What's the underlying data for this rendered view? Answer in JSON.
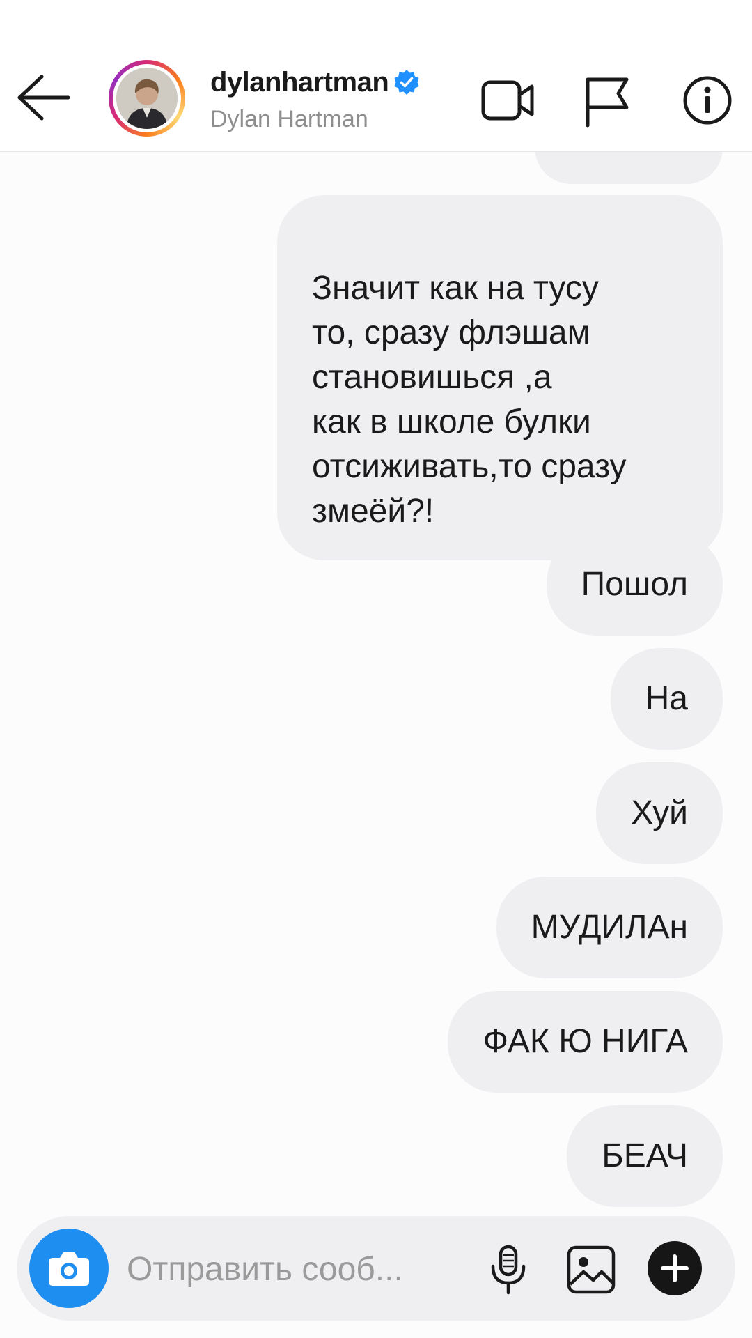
{
  "header": {
    "username": "dylanhartman",
    "full_name": "Dylan Hartman",
    "verified": true
  },
  "messages": [
    {
      "text": "Значит как на тусу\nто, сразу флэшам\nстановишься ,а\nкак в школе булки\nотсиживать,то сразу\nзмеёй?!",
      "sender": "me"
    },
    {
      "text": "Пошол",
      "sender": "me"
    },
    {
      "text": "На",
      "sender": "me"
    },
    {
      "text": "Хуй",
      "sender": "me"
    },
    {
      "text": "МУДИЛАн",
      "sender": "me"
    },
    {
      "text": "ФАК Ю НИГА",
      "sender": "me"
    },
    {
      "text": "БЕАЧ",
      "sender": "me"
    }
  ],
  "composer": {
    "placeholder": "Отправить сооб..."
  },
  "colors": {
    "bubble": "#efeff2",
    "camera_button": "#1f8ef1",
    "verified_badge": "#1e90ff"
  },
  "icons": {
    "back": "arrow-left-icon",
    "video": "video-camera-icon",
    "flag": "flag-icon",
    "info": "info-icon",
    "camera": "camera-icon",
    "mic": "microphone-icon",
    "gallery": "image-icon",
    "plus": "plus-icon"
  }
}
